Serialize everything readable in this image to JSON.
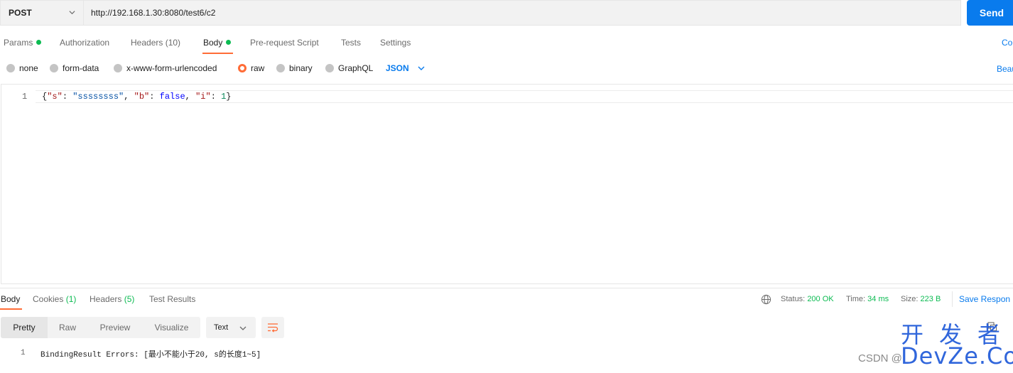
{
  "request": {
    "method": "POST",
    "url": "http://192.168.1.30:8080/test6/c2",
    "send_label": "Send"
  },
  "request_tabs": {
    "params": "Params",
    "authorization": "Authorization",
    "headers": "Headers",
    "headers_count": "(10)",
    "body": "Body",
    "pre_request": "Pre-request Script",
    "tests": "Tests",
    "settings": "Settings",
    "cookies_link": "Co"
  },
  "body_types": {
    "none": "none",
    "form_data": "form-data",
    "urlencoded": "x-www-form-urlencoded",
    "raw": "raw",
    "binary": "binary",
    "graphql": "GraphQL",
    "selected_language": "JSON",
    "beautify_link": "Beau"
  },
  "editor": {
    "line_number": "1",
    "tokens": {
      "open": "{",
      "k1": "\"s\"",
      "c1": ": ",
      "v1": "\"ssssssss\"",
      "sep1": ", ",
      "k2": "\"b\"",
      "c2": ": ",
      "v2": "false",
      "sep2": ", ",
      "k3": "\"i\"",
      "c3": ": ",
      "v3": "1",
      "close": "}"
    }
  },
  "response_tabs": {
    "body": "Body",
    "cookies": "Cookies",
    "cookies_count": "(1)",
    "headers": "Headers",
    "headers_count": "(5)",
    "test_results": "Test Results"
  },
  "response_meta": {
    "status_label": "Status:",
    "status_value": "200 OK",
    "time_label": "Time:",
    "time_value": "34 ms",
    "size_label": "Size:",
    "size_value": "223 B",
    "save_response": "Save Respon"
  },
  "view_modes": {
    "pretty": "Pretty",
    "raw": "Raw",
    "preview": "Preview",
    "visualize": "Visualize",
    "format": "Text"
  },
  "response_body": {
    "line_number": "1",
    "text": "BindingResult Errors: [最小不能小于20, s的长度1~5]"
  },
  "watermarks": {
    "devze_cn": "开发者",
    "devze_en": "DevZe.CoM",
    "csdn": "CSDN @"
  },
  "colors": {
    "accent_orange": "#ff6c37",
    "link_blue": "#097bed",
    "status_green": "#0cbb52"
  }
}
